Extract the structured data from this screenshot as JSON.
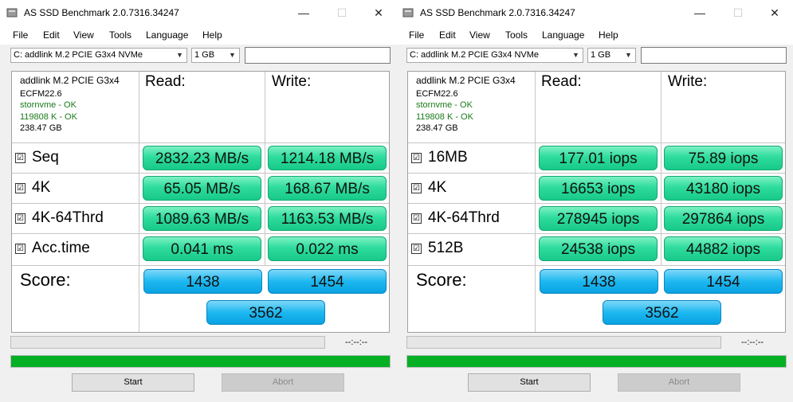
{
  "windows": [
    {
      "title": "AS SSD Benchmark 2.0.7316.34247",
      "menu": [
        "File",
        "Edit",
        "View",
        "Tools",
        "Language",
        "Help"
      ],
      "drive_select": "C: addlink M.2 PCIE G3x4 NVMe",
      "size_select": "1 GB",
      "device": {
        "name": "addlink M.2 PCIE G3x4",
        "firmware": "ECFM22.6",
        "driver_status": "stornvme - OK",
        "alignment_status": "119808 K - OK",
        "capacity": "238.47 GB"
      },
      "read_header": "Read:",
      "write_header": "Write:",
      "rows": [
        {
          "label": "Seq",
          "read": "2832.23 MB/s",
          "write": "1214.18 MB/s"
        },
        {
          "label": "4K",
          "read": "65.05 MB/s",
          "write": "168.67 MB/s"
        },
        {
          "label": "4K-64Thrd",
          "read": "1089.63 MB/s",
          "write": "1163.53 MB/s"
        },
        {
          "label": "Acc.time",
          "read": "0.041 ms",
          "write": "0.022 ms"
        }
      ],
      "score_label": "Score:",
      "score_read": "1438",
      "score_write": "1454",
      "score_total": "3562",
      "time_text": "--:--:--",
      "start_label": "Start",
      "abort_label": "Abort",
      "checkbox_mark": "☑",
      "progress": 1.0
    },
    {
      "title": "AS SSD Benchmark 2.0.7316.34247",
      "menu": [
        "File",
        "Edit",
        "View",
        "Tools",
        "Language",
        "Help"
      ],
      "drive_select": "C: addlink M.2 PCIE G3x4 NVMe",
      "size_select": "1 GB",
      "device": {
        "name": "addlink M.2 PCIE G3x4",
        "firmware": "ECFM22.6",
        "driver_status": "stornvme - OK",
        "alignment_status": "119808 K - OK",
        "capacity": "238.47 GB"
      },
      "read_header": "Read:",
      "write_header": "Write:",
      "rows": [
        {
          "label": "16MB",
          "read": "177.01 iops",
          "write": "75.89 iops"
        },
        {
          "label": "4K",
          "read": "16653 iops",
          "write": "43180 iops"
        },
        {
          "label": "4K-64Thrd",
          "read": "278945 iops",
          "write": "297864 iops"
        },
        {
          "label": "512B",
          "read": "24538 iops",
          "write": "44882 iops"
        }
      ],
      "score_label": "Score:",
      "score_read": "1438",
      "score_write": "1454",
      "score_total": "3562",
      "time_text": "--:--:--",
      "start_label": "Start",
      "abort_label": "Abort",
      "checkbox_mark": "☑",
      "progress": 1.0
    }
  ],
  "icons": {
    "app": "drive-icon",
    "minimize": "minimize-icon",
    "maximize": "maximize-icon",
    "close": "close-icon"
  },
  "colors": {
    "value_box": "#2fdc9e",
    "score_box": "#1db8f0",
    "progress_fill": "#06b025"
  }
}
